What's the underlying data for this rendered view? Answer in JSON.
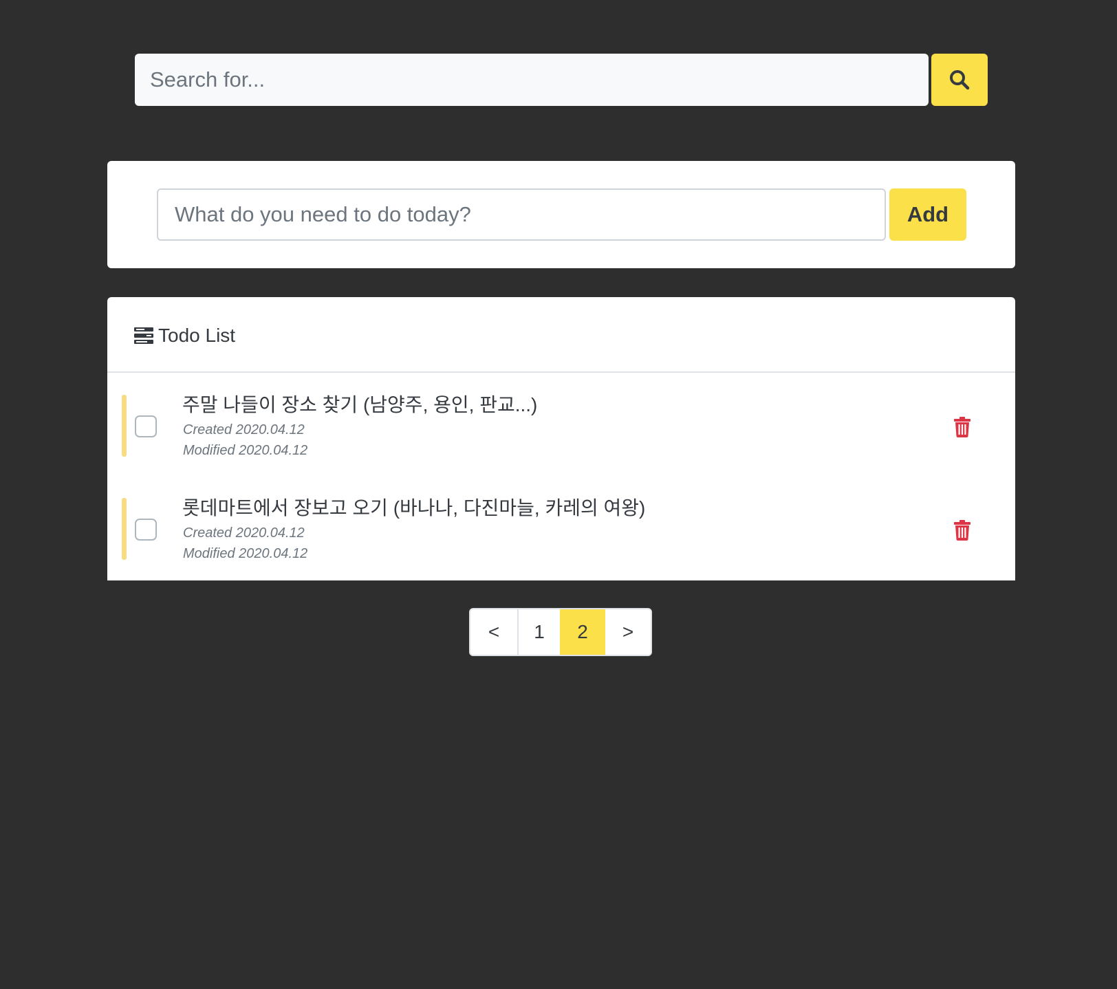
{
  "search": {
    "placeholder": "Search for...",
    "button_icon": "search-icon"
  },
  "add_form": {
    "placeholder": "What do you need to do today?",
    "button_label": "Add"
  },
  "todo_list": {
    "header_icon": "list-icon",
    "title": "Todo List",
    "items": [
      {
        "title": "주말 나들이 장소 찾기 (남양주, 용인, 판교...)",
        "created": "Created 2020.04.12",
        "modified": "Modified 2020.04.12",
        "checked": false,
        "delete_icon": "trash-icon"
      },
      {
        "title": "롯데마트에서 장보고 오기 (바나나, 다진마늘, 카레의 여왕)",
        "created": "Created 2020.04.12",
        "modified": "Modified 2020.04.12",
        "checked": false,
        "delete_icon": "trash-icon"
      }
    ]
  },
  "pagination": {
    "prev_label": "<",
    "pages": [
      "1",
      "2"
    ],
    "current_page": "2",
    "next_label": ">"
  },
  "colors": {
    "background": "#2e2e2f",
    "accent_yellow": "#fbe04a",
    "item_bar": "#f8db82",
    "delete_red": "#dc3545"
  }
}
